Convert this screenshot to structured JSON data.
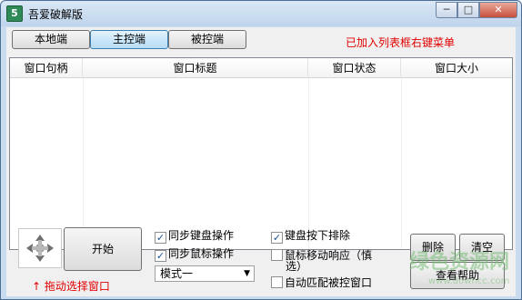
{
  "window": {
    "title": "吾爱破解版",
    "app_icon": "app-logo-icon",
    "minimize_label": "─",
    "maximize_label": "□",
    "close_label": "✕"
  },
  "tabs": [
    {
      "label": "本地端",
      "active": false
    },
    {
      "label": "主控端",
      "active": true
    },
    {
      "label": "被控端",
      "active": false
    }
  ],
  "hint_text": "已加入列表框右键菜单",
  "list": {
    "columns": [
      "窗口句柄",
      "窗口标题",
      "窗口状态",
      "窗口大小"
    ],
    "rows": []
  },
  "controls": {
    "move_pad_icon": "four-way-arrow-icon",
    "start_label": "开始",
    "drag_hint": "↑ 拖动选择窗口",
    "sync_keyboard_label": "同步键盘操作",
    "sync_keyboard_checked": true,
    "sync_mouse_label": "同步鼠标操作",
    "sync_mouse_checked": true,
    "mode_value": "模式一",
    "key_down_exclude_label": "键盘按下排除",
    "key_down_exclude_checked": true,
    "mouse_move_label": "鼠标移动响应（慎",
    "mouse_move_label_2": "选）",
    "mouse_move_checked": false,
    "auto_match_label": "自动匹配被控窗口",
    "auto_match_checked": false,
    "delete_label": "删除",
    "clear_label": "清空",
    "help_label": "查看帮助"
  },
  "watermark": {
    "text": "绿色资源网",
    "sub": "www.downcc.com"
  }
}
